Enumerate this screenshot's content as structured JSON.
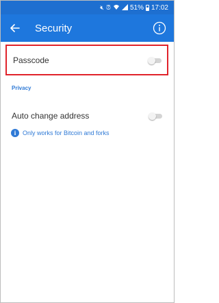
{
  "status_bar": {
    "icons": [
      "mute-icon",
      "alarm-icon",
      "wifi-icon",
      "signal-icon"
    ],
    "battery_percent": "51%",
    "time": "17:02"
  },
  "app_bar": {
    "back_icon": "arrow-left-icon",
    "title": "Security",
    "info_icon": "info-circle-icon"
  },
  "passcode": {
    "label": "Passcode",
    "enabled": false
  },
  "privacy_section": {
    "header": "Privacy"
  },
  "auto_change_address": {
    "label": "Auto change address",
    "enabled": false,
    "note": "Only works for Bitcoin and forks",
    "note_icon": "info-icon"
  },
  "colors": {
    "accent": "#1e77dd",
    "status_bar": "#1e6fd0",
    "highlight": "#e0222a",
    "section_text": "#2f7ad6"
  }
}
